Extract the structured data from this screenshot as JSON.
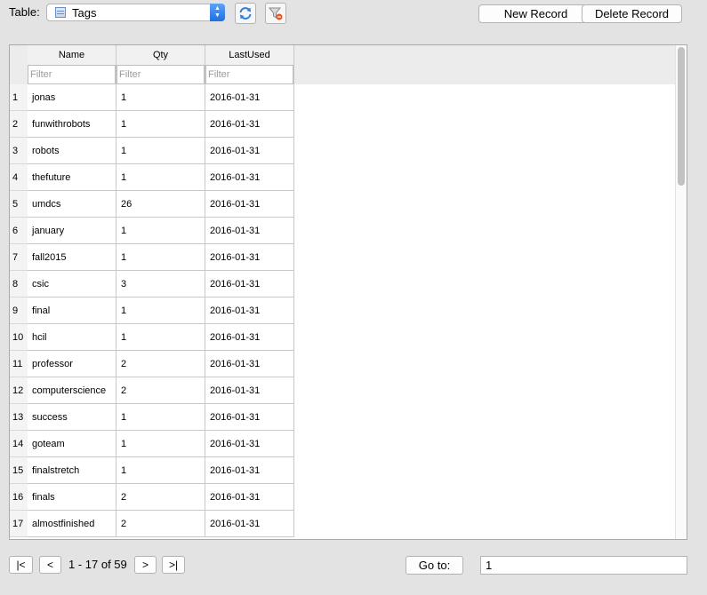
{
  "toolbar": {
    "table_label": "Table:",
    "table_value": "Tags",
    "new_record": "New Record",
    "delete_record": "Delete Record"
  },
  "grid": {
    "columns": [
      "Name",
      "Qty",
      "LastUsed"
    ],
    "filter_placeholder": "Filter",
    "rows": [
      {
        "num": "1",
        "name": "jonas",
        "qty": "1",
        "last": "2016-01-31"
      },
      {
        "num": "2",
        "name": "funwithrobots",
        "qty": "1",
        "last": "2016-01-31"
      },
      {
        "num": "3",
        "name": "robots",
        "qty": "1",
        "last": "2016-01-31"
      },
      {
        "num": "4",
        "name": "thefuture",
        "qty": "1",
        "last": "2016-01-31"
      },
      {
        "num": "5",
        "name": "umdcs",
        "qty": "26",
        "last": "2016-01-31"
      },
      {
        "num": "6",
        "name": "january",
        "qty": "1",
        "last": "2016-01-31"
      },
      {
        "num": "7",
        "name": "fall2015",
        "qty": "1",
        "last": "2016-01-31"
      },
      {
        "num": "8",
        "name": "csic",
        "qty": "3",
        "last": "2016-01-31"
      },
      {
        "num": "9",
        "name": "final",
        "qty": "1",
        "last": "2016-01-31"
      },
      {
        "num": "10",
        "name": "hcil",
        "qty": "1",
        "last": "2016-01-31"
      },
      {
        "num": "11",
        "name": "professor",
        "qty": "2",
        "last": "2016-01-31"
      },
      {
        "num": "12",
        "name": "computerscience",
        "qty": "2",
        "last": "2016-01-31"
      },
      {
        "num": "13",
        "name": "success",
        "qty": "1",
        "last": "2016-01-31"
      },
      {
        "num": "14",
        "name": "goteam",
        "qty": "1",
        "last": "2016-01-31"
      },
      {
        "num": "15",
        "name": "finalstretch",
        "qty": "1",
        "last": "2016-01-31"
      },
      {
        "num": "16",
        "name": "finals",
        "qty": "2",
        "last": "2016-01-31"
      },
      {
        "num": "17",
        "name": "almostfinished",
        "qty": "2",
        "last": "2016-01-31"
      }
    ]
  },
  "pager": {
    "first": "|<",
    "prev": "<",
    "info": "1 - 17 of 59",
    "next": ">",
    "last": ">|",
    "goto_label": "Go to:",
    "goto_value": "1"
  },
  "icons": {
    "refresh": "refresh-icon",
    "clear_filters": "filter-clear-icon",
    "table": "table-icon"
  }
}
